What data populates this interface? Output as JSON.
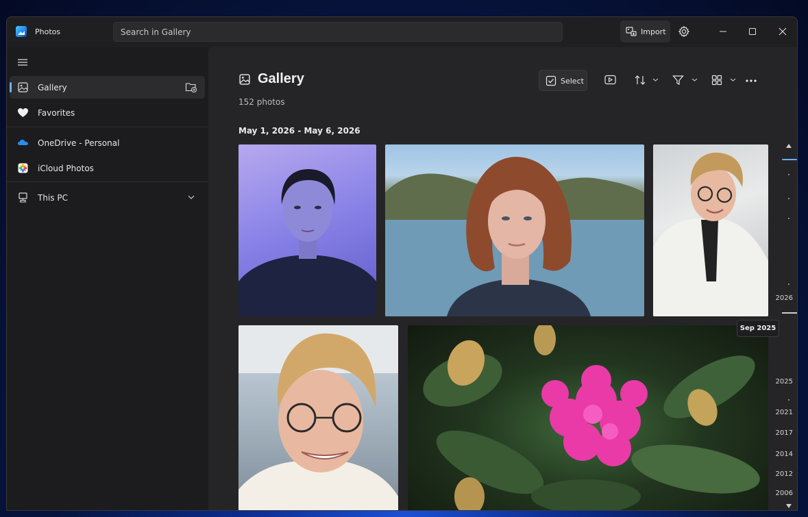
{
  "window": {
    "app_title": "Photos",
    "search_placeholder": "Search in Gallery",
    "import_label": "Import"
  },
  "sidebar": {
    "items": [
      {
        "label": "Gallery",
        "icon": "gallery-icon",
        "active": true
      },
      {
        "label": "Favorites",
        "icon": "heart-icon"
      },
      {
        "label": "OneDrive - Personal",
        "icon": "onedrive-icon"
      },
      {
        "label": "iCloud Photos",
        "icon": "icloud-photos-icon"
      },
      {
        "label": "This PC",
        "icon": "pc-icon"
      }
    ],
    "accent": "#6ab0ff"
  },
  "main": {
    "title": "Gallery",
    "count": "152 photos",
    "select_label": "Select",
    "date_range": "May 1, 2026 - May 6, 2026",
    "tooltip": "Sep 2025",
    "timeline_years": [
      "2026",
      "2025",
      "2021",
      "2017",
      "2014",
      "2012",
      "2006"
    ]
  }
}
